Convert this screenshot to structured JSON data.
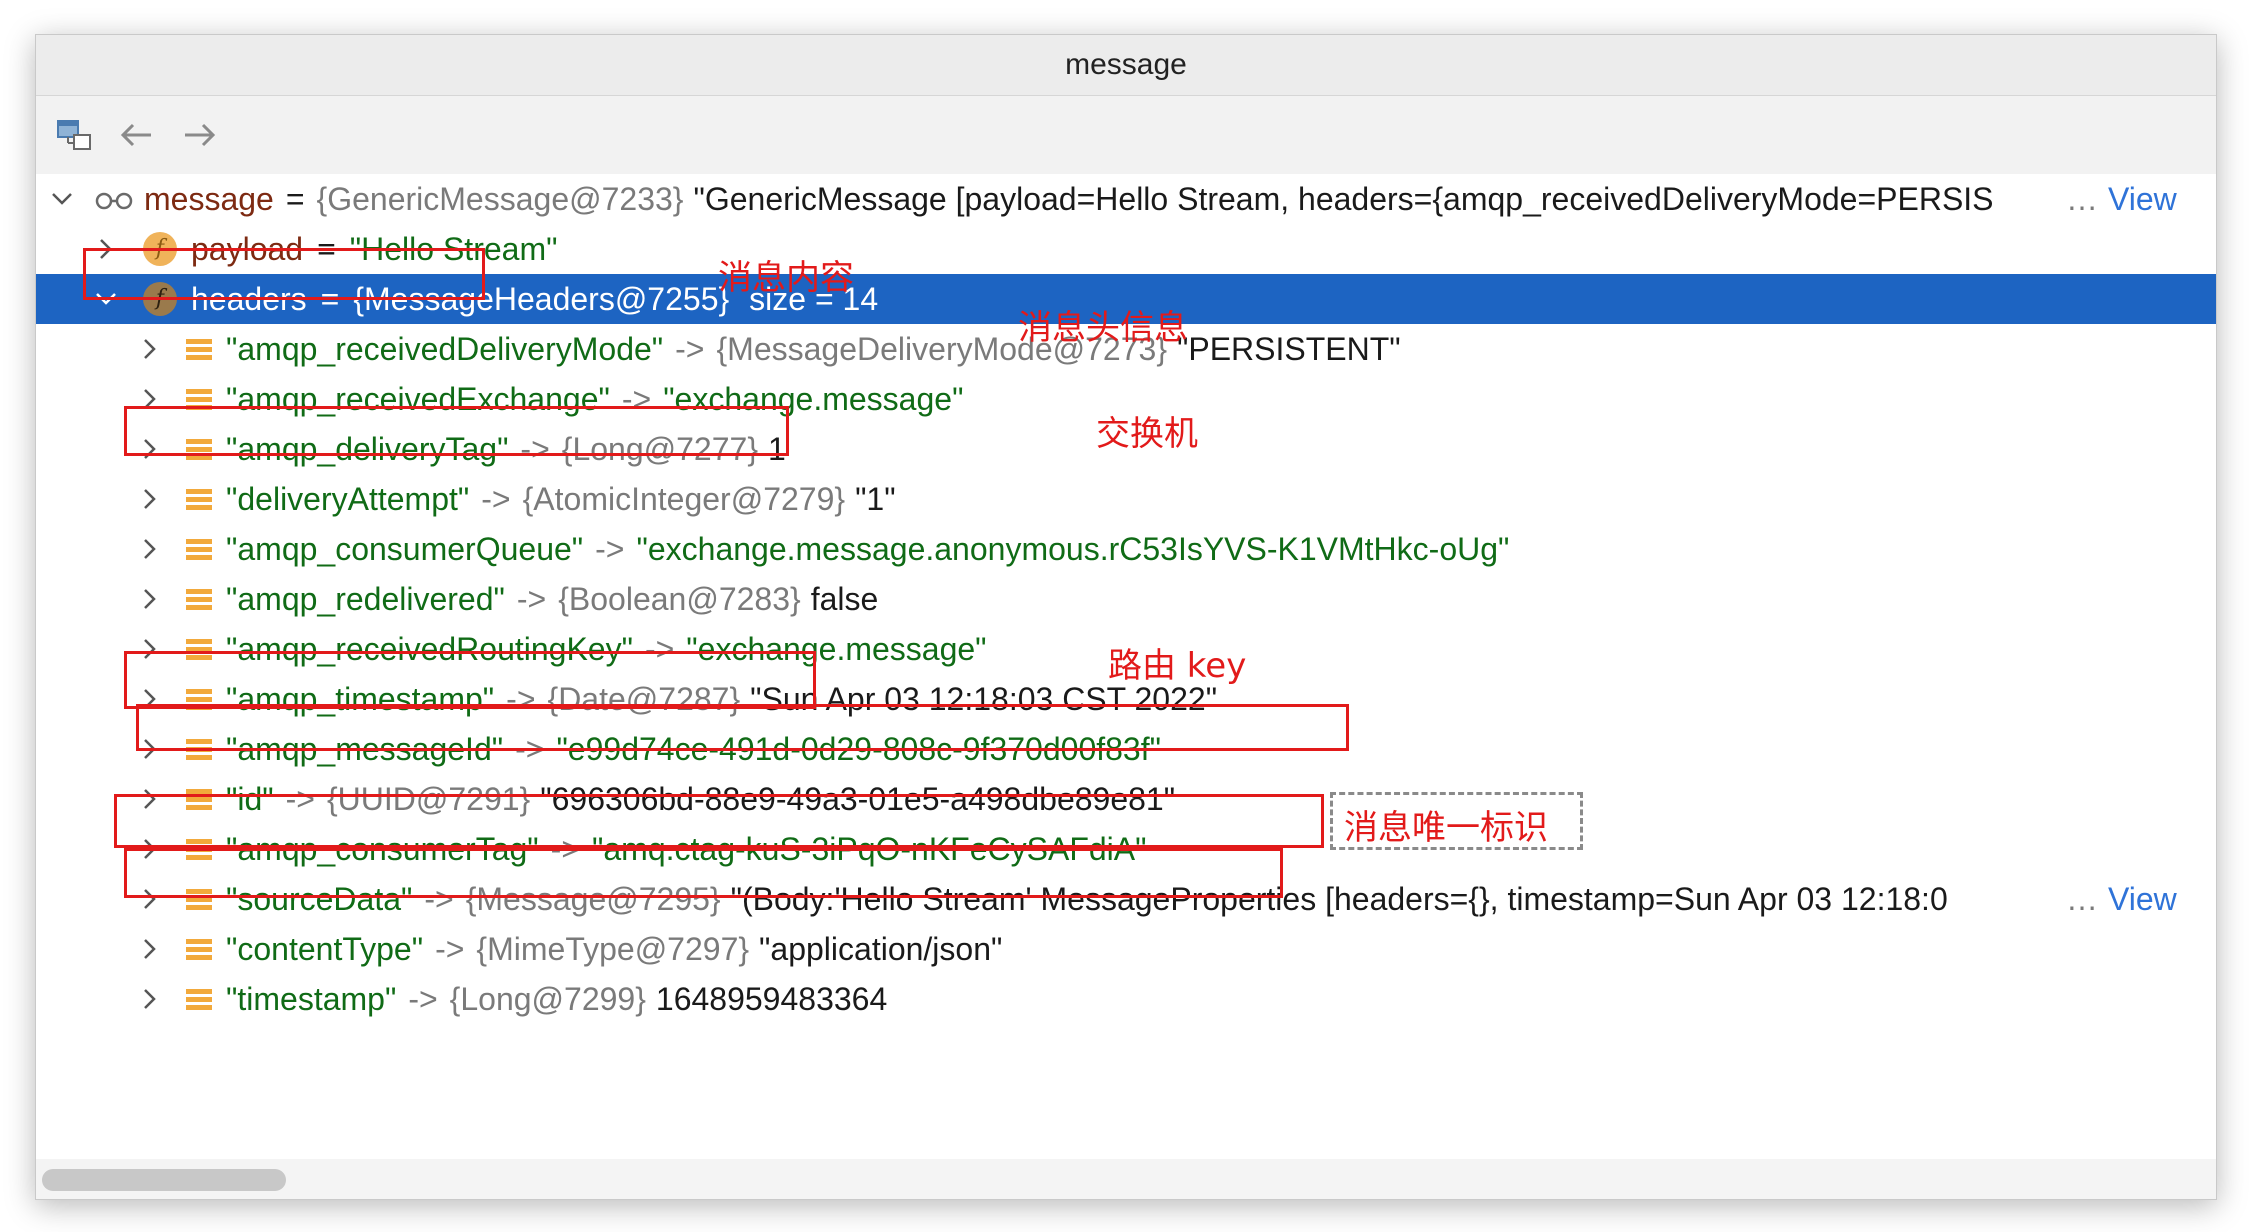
{
  "window": {
    "title": "message"
  },
  "toolbar": {
    "buttons": [
      {
        "icon": "hierarchy-icon"
      },
      {
        "icon": "back-arrow-icon"
      },
      {
        "icon": "forward-arrow-icon"
      }
    ]
  },
  "root": {
    "name": "message",
    "eq": "=",
    "type": "{GenericMessage@7233}",
    "value": "\"GenericMessage [payload=Hello Stream, headers={amqp_receivedDeliveryMode=PERSIS",
    "ellipsis": "…",
    "link": "View"
  },
  "payload": {
    "name": "payload",
    "eq": "=",
    "value": "\"Hello Stream\""
  },
  "headers": {
    "name": "headers",
    "eq": "=",
    "type": "{MessageHeaders@7255}",
    "size_text": "size = 14"
  },
  "entries": [
    {
      "key": "\"amqp_receivedDeliveryMode\"",
      "arrow": "->",
      "type": "{MessageDeliveryMode@7273}",
      "value": "\"PERSISTENT\"",
      "value_style": "val"
    },
    {
      "key": "\"amqp_receivedExchange\"",
      "arrow": "->",
      "type": "",
      "value": "\"exchange.message\"",
      "value_style": "str"
    },
    {
      "key": "\"amqp_deliveryTag\"",
      "arrow": "->",
      "type": "{Long@7277}",
      "value": "1",
      "value_style": "val"
    },
    {
      "key": "\"deliveryAttempt\"",
      "arrow": "->",
      "type": "{AtomicInteger@7279}",
      "value": "\"1\"",
      "value_style": "val"
    },
    {
      "key": "\"amqp_consumerQueue\"",
      "arrow": "->",
      "type": "",
      "value": "\"exchange.message.anonymous.rC53IsYVS-K1VMtHkc-oUg\"",
      "value_style": "str"
    },
    {
      "key": "\"amqp_redelivered\"",
      "arrow": "->",
      "type": "{Boolean@7283}",
      "value": "false",
      "value_style": "val"
    },
    {
      "key": "\"amqp_receivedRoutingKey\"",
      "arrow": "->",
      "type": "",
      "value": "\"exchange.message\"",
      "value_style": "str"
    },
    {
      "key": "\"amqp_timestamp\"",
      "arrow": "->",
      "type": "{Date@7287}",
      "value": "\"Sun Apr 03 12:18:03 CST 2022\"",
      "value_style": "val"
    },
    {
      "key": "\"amqp_messageId\"",
      "arrow": "->",
      "type": "",
      "value": "\"e99d74ce-491d-0d29-808c-9f370d00f83f\"",
      "value_style": "str"
    },
    {
      "key": "\"id\"",
      "arrow": "->",
      "type": "{UUID@7291}",
      "value": "\"696306bd-88e9-49a3-01e5-a498dbe89e81\"",
      "value_style": "val"
    },
    {
      "key": "\"amqp_consumerTag\"",
      "arrow": "->",
      "type": "",
      "value": "\"amq.ctag-kuS-3iPqO-nKFeCySAFdiA\"",
      "value_style": "str"
    },
    {
      "key": "\"sourceData\"",
      "arrow": "->",
      "type": "{Message@7295}",
      "value": "\"(Body:'Hello Stream' MessageProperties [headers={}, timestamp=Sun Apr 03 12:18:0",
      "value_style": "val",
      "ellipsis": "…",
      "link": "View"
    },
    {
      "key": "\"contentType\"",
      "arrow": "->",
      "type": "{MimeType@7297}",
      "value": "\"application/json\"",
      "value_style": "val"
    },
    {
      "key": "\"timestamp\"",
      "arrow": "->",
      "type": "{Long@7299}",
      "value": "1648959483364",
      "value_style": "val"
    }
  ],
  "annotations": {
    "payload_note": "消息内容",
    "headers_note": "消息头信息",
    "exchange_note": "交换机",
    "routing_note": "路由 key",
    "id_note": "消息唯一标识"
  },
  "colors": {
    "selection": "#1d64c2",
    "string": "#106b16",
    "annotation": "#e21a1a",
    "link": "#2f73d8"
  }
}
